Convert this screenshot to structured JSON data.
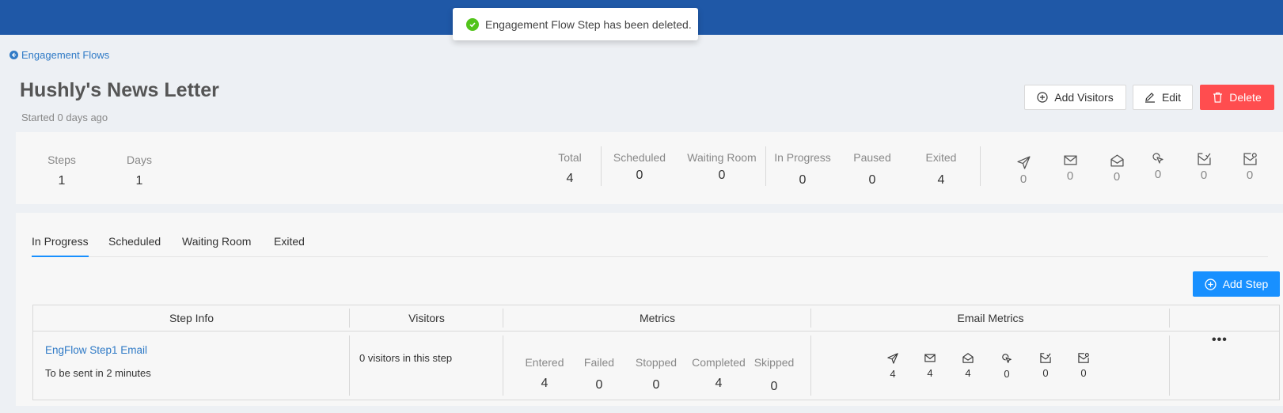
{
  "toast": {
    "message": "Engagement Flow Step has been deleted.",
    "icon": "check-circle-icon"
  },
  "breadcrumb": {
    "back_label": "Engagement Flows"
  },
  "page": {
    "title": "Hushly's News Letter",
    "subtitle": "Started 0 days ago"
  },
  "actions": {
    "add_visitors": "Add Visitors",
    "edit": "Edit",
    "delete": "Delete"
  },
  "summary": {
    "steps": {
      "label": "Steps",
      "value": "1"
    },
    "days": {
      "label": "Days",
      "value": "1"
    },
    "total": {
      "label": "Total",
      "value": "4"
    },
    "scheduled": {
      "label": "Scheduled",
      "value": "0"
    },
    "waiting_room": {
      "label": "Waiting Room",
      "value": "0"
    },
    "in_progress": {
      "label": "In Progress",
      "value": "0"
    },
    "paused": {
      "label": "Paused",
      "value": "0"
    },
    "exited": {
      "label": "Exited",
      "value": "4"
    },
    "email": {
      "sent": "0",
      "delivered": "0",
      "opened": "0",
      "clicked": "0",
      "replied": "0",
      "bounced": "0"
    }
  },
  "tabs": [
    "In Progress",
    "Scheduled",
    "Waiting Room",
    "Exited"
  ],
  "add_step": "Add Step",
  "table": {
    "headers": [
      "Step Info",
      "Visitors",
      "Metrics",
      "Email Metrics"
    ],
    "row": {
      "step_name": "EngFlow Step1 Email",
      "step_note": "To be sent in 2 minutes",
      "visitors": "0 visitors in this step",
      "metrics": [
        {
          "label": "Entered",
          "value": "4"
        },
        {
          "label": "Failed",
          "value": "0"
        },
        {
          "label": "Stopped",
          "value": "0"
        },
        {
          "label": "Completed",
          "value": "4"
        },
        {
          "label": "Skipped",
          "value": "0"
        }
      ],
      "email": {
        "sent": "4",
        "delivered": "4",
        "opened": "4",
        "clicked": "0",
        "replied": "0",
        "bounced": "0"
      },
      "more": "•••"
    }
  },
  "colors": {
    "topbar": "#1f58a7",
    "primary": "#1890ff",
    "danger": "#ff4d4f",
    "link": "#2f7ac6",
    "success": "#52c41a"
  }
}
